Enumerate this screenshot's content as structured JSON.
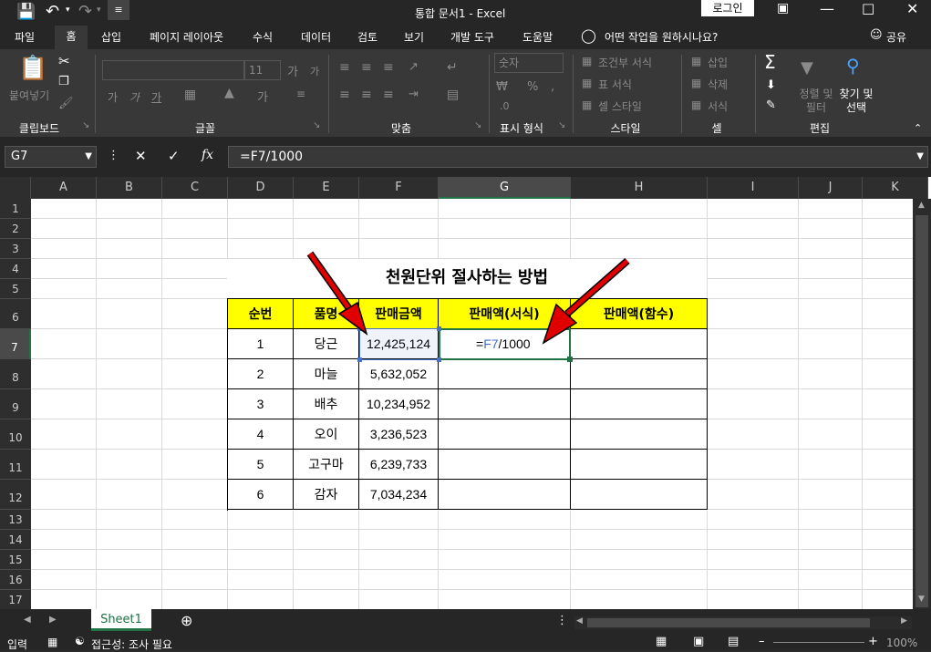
{
  "window": {
    "title": "통합 문서1  -  Excel",
    "login": "로그인"
  },
  "tabs": [
    "파일",
    "홈",
    "삽입",
    "페이지 레이아웃",
    "수식",
    "데이터",
    "검토",
    "보기",
    "개발 도구",
    "도움말"
  ],
  "tell_me": "어떤 작업을 원하시나요?",
  "share": "공유",
  "ribbon": {
    "groups": [
      "클립보드",
      "글꼴",
      "맞춤",
      "표시 형식",
      "스타일",
      "셀",
      "편집"
    ],
    "paste": "붙여넣기",
    "font_size": "11",
    "number_format": "숫자",
    "percent": "%",
    "styles": [
      "조건부 서식",
      "표 서식",
      "셀 스타일"
    ],
    "cells": [
      "삽입",
      "삭제",
      "서식"
    ],
    "sort": "정렬 및\n필터",
    "find": "찾기 및\n선택"
  },
  "formula_bar": {
    "name_box": "G7",
    "formula": "=F7/1000"
  },
  "columns": [
    "A",
    "B",
    "C",
    "D",
    "E",
    "F",
    "G",
    "H",
    "I",
    "J",
    "K"
  ],
  "rows": [
    "1",
    "2",
    "3",
    "4",
    "5",
    "6",
    "7",
    "8",
    "9",
    "10",
    "11",
    "12",
    "13",
    "14",
    "15",
    "16",
    "17"
  ],
  "sheet": {
    "title": "천원단위 절사하는 방법",
    "headers": [
      "순번",
      "품명",
      "판매금액",
      "판매액(서식)",
      "판매액(함수)"
    ],
    "data": [
      [
        "1",
        "당근",
        "12,425,124",
        "",
        ""
      ],
      [
        "2",
        "마늘",
        "5,632,052",
        "",
        ""
      ],
      [
        "3",
        "배추",
        "10,234,952",
        "",
        ""
      ],
      [
        "4",
        "오이",
        "3,236,523",
        "",
        ""
      ],
      [
        "5",
        "고구마",
        "6,239,733",
        "",
        ""
      ],
      [
        "6",
        "감자",
        "7,034,234",
        "",
        ""
      ]
    ],
    "edit_cell": {
      "eq": "=",
      "ref": "F7",
      "rest": "/1000"
    }
  },
  "sheet_tab": "Sheet1",
  "status": {
    "mode": "입력",
    "accessibility": "접근성: 조사 필요",
    "zoom": "100%"
  },
  "colors": {
    "header_fill": "#ffff00",
    "ref_blue": "#4472c4",
    "select_green": "#217346",
    "arrow_red": "#e00000"
  }
}
